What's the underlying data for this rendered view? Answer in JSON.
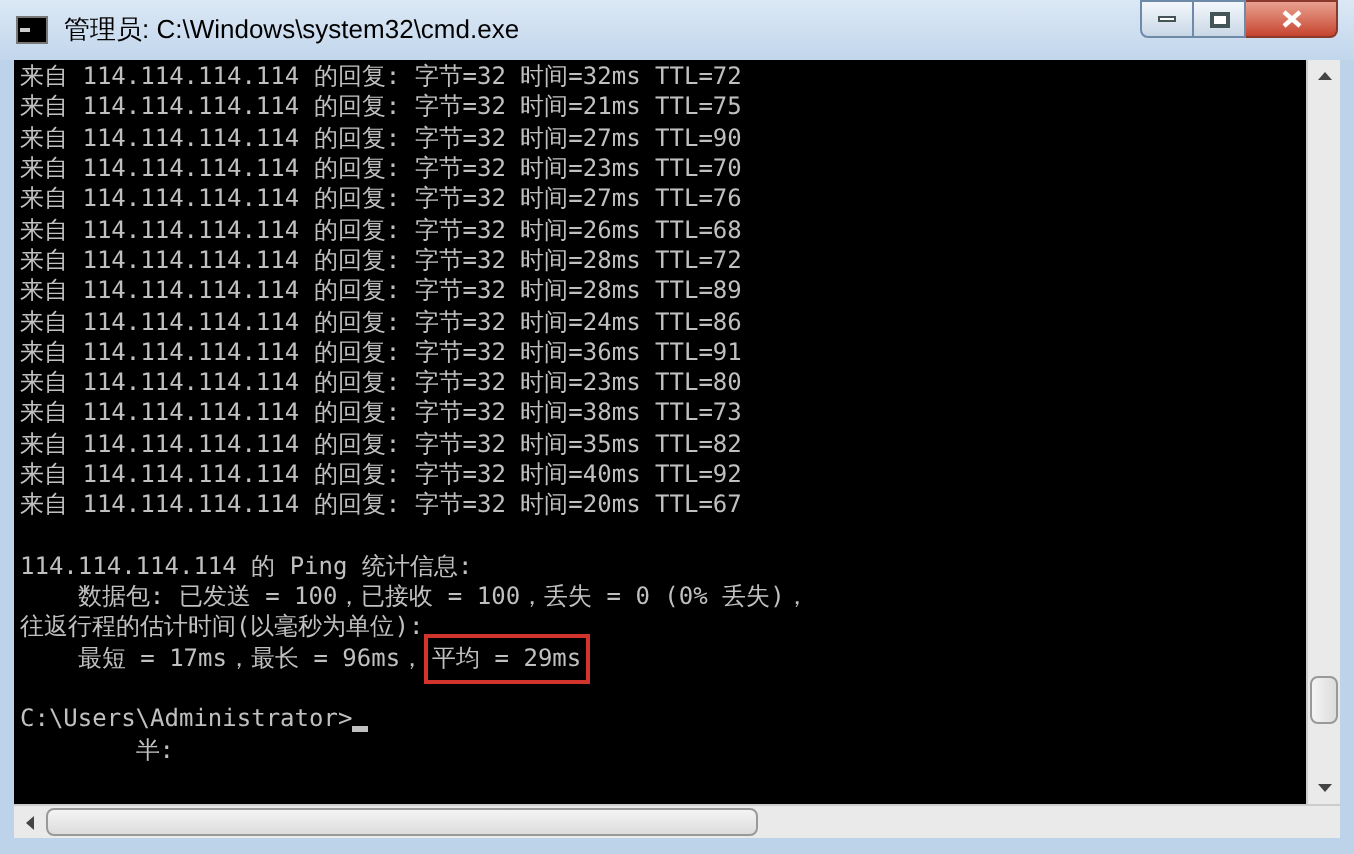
{
  "window": {
    "title": "管理员: C:\\Windows\\system32\\cmd.exe"
  },
  "console": {
    "blocks": [
      {
        "lines": [
          {
            "text": "来自 114.114.114.114 的回复: 字节=32 时间=32ms TTL=72"
          },
          {
            "text": "来自 114.114.114.114 的回复: 字节=32 时间=21ms TTL=75"
          },
          {
            "text": "来自 114.114.114.114 的回复: 字节=32 时间=27ms TTL=90"
          },
          {
            "text": "来自 114.114.114.114 的回复: 字节=32 时间=23ms TTL=70"
          },
          {
            "text": "来自 114.114.114.114 的回复: 字节=32 时间=27ms TTL=76"
          },
          {
            "text": "来自 114.114.114.114 的回复: 字节=32 时间=26ms TTL=68"
          },
          {
            "text": "来自 114.114.114.114 的回复: 字节=32 时间=28ms TTL=72"
          },
          {
            "text": "来自 114.114.114.114 的回复: 字节=32 时间=28ms TTL=89"
          },
          {
            "text": "来自 114.114.114.114 的回复: 字节=32 时间=24ms TTL=86"
          },
          {
            "text": "来自 114.114.114.114 的回复: 字节=32 时间=36ms TTL=91"
          },
          {
            "text": "来自 114.114.114.114 的回复: 字节=32 时间=23ms TTL=80"
          },
          {
            "text": "来自 114.114.114.114 的回复: 字节=32 时间=38ms TTL=73"
          },
          {
            "text": "来自 114.114.114.114 的回复: 字节=32 时间=35ms TTL=82"
          },
          {
            "text": "来自 114.114.114.114 的回复: 字节=32 时间=40ms TTL=92"
          },
          {
            "text": "来自 114.114.114.114 的回复: 字节=32 时间=20ms TTL=67"
          }
        ]
      },
      {
        "lines": [
          {
            "text": "114.114.114.114 的 Ping 统计信息:"
          },
          {
            "text": "    数据包: 已发送 = 100，已接收 = 100，丢失 = 0 (0% 丢失)，"
          },
          {
            "text": "往返行程的估计时间(以毫秒为单位):"
          },
          {
            "text": "    最短 = 17ms，最长 = 96ms，",
            "highlight": "平均 = 29ms"
          }
        ]
      },
      {
        "lines": [
          {
            "text": "C:\\Users\\Administrator>",
            "cursor": true
          },
          {
            "text": "        半:"
          }
        ]
      }
    ]
  }
}
